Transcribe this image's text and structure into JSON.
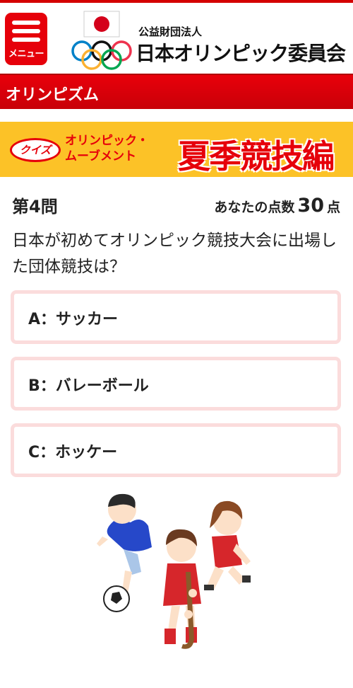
{
  "header": {
    "menu_label": "メニュー",
    "org_prefix": "公益財団法人",
    "org_name": "日本オリンピック委員会"
  },
  "section": {
    "title": "オリンピズム"
  },
  "banner": {
    "badge": "クイズ",
    "subtitle_line1": "オリンピック・",
    "subtitle_line2": "ムーブメント",
    "title": "夏季競技編"
  },
  "quiz": {
    "question_number": "第4問",
    "score_label": "あなたの点数",
    "score_value": "30",
    "score_unit": "点",
    "question_text": "日本が初めてオリンピック競技大会に出場した団体競技は？",
    "options": [
      {
        "label": "A：サッカー"
      },
      {
        "label": "B：バレーボール"
      },
      {
        "label": "C：ホッケー"
      }
    ]
  },
  "colors": {
    "brand_red": "#e6000a",
    "banner_yellow": "#fcc227",
    "option_border": "#fbdcdc"
  },
  "icons": [
    "menu-icon",
    "olympic-logo",
    "sports-illustration"
  ]
}
